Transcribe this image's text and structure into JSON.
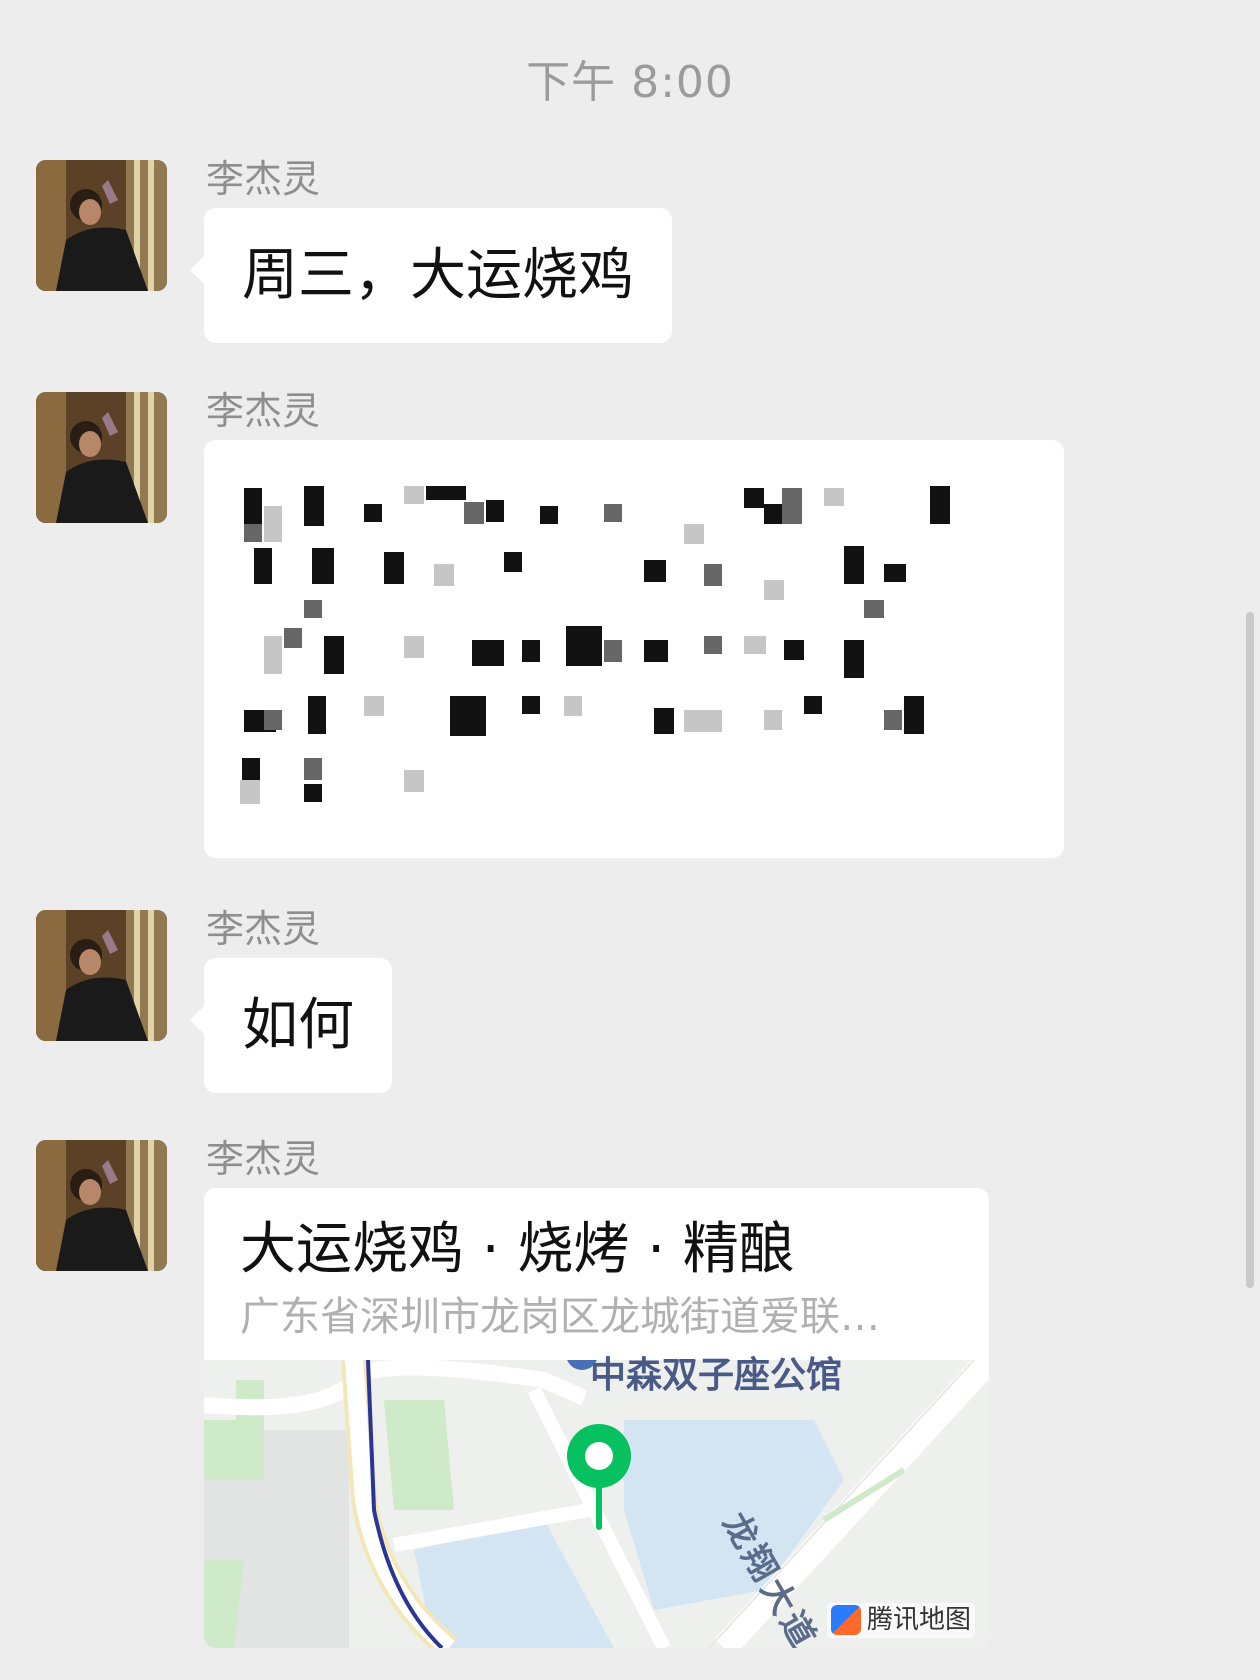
{
  "timestamp": "下午 8:00",
  "messages": [
    {
      "sender": "李杰灵",
      "text": "周三，大运烧鸡"
    },
    {
      "sender": "李杰灵",
      "text": ""
    },
    {
      "sender": "李杰灵",
      "text": "如何"
    },
    {
      "sender": "李杰灵"
    }
  ],
  "location": {
    "title": "大运烧鸡 · 烧烤 · 精酿",
    "address": "广东省深圳市龙岗区龙城街道爱联…",
    "map_label_building": "中森双子座公馆",
    "map_label_road": "龙翔大道",
    "map_brand": "腾讯地图"
  },
  "colors": {
    "background": "#ededed",
    "bubble": "#ffffff",
    "pin": "#07c160",
    "sender_text": "#8e8e8e"
  },
  "icons": {
    "avatar": "user-avatar-photo",
    "pin": "location-pin-icon",
    "brand": "tencent-map-logo-icon"
  }
}
